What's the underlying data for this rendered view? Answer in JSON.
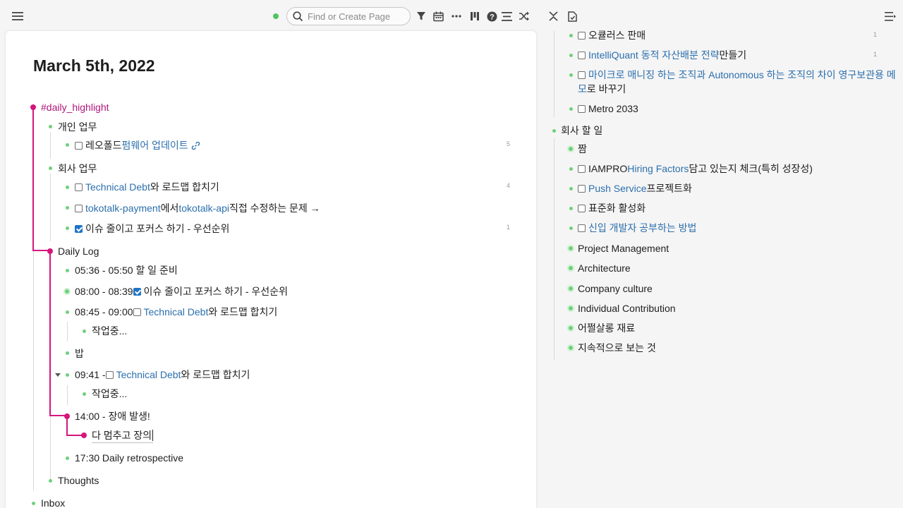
{
  "toolbar": {
    "search_placeholder": "Find or Create Page"
  },
  "colors": {
    "accent": "#d6157c",
    "link": "#2c6fad",
    "bullet": "#6fd07a",
    "checkbox_checked": "#1f74c6"
  },
  "page": {
    "title": "March 5th, 2022",
    "highlight_tag": "#daily_highlight",
    "personal_work": "개인 업무",
    "personal_item_1_pre": "레오폴드 ",
    "personal_item_1_link": "펌웨어 업데이트",
    "personal_item_1_count": "5",
    "company_work": "회사 업무",
    "company_item_1_link": "Technical Debt",
    "company_item_1_rest": "와 로드맵 합치기",
    "company_item_1_count": "4",
    "company_item_2_link1": "tokotalk-payment",
    "company_item_2_mid": "에서 ",
    "company_item_2_link2": "tokotalk-api",
    "company_item_2_rest": " 직접 수정하는 문제 →",
    "company_item_3": "이슈 줄이고 포커스 하기 - 우선순위",
    "company_item_3_count": "1",
    "daily_log": "Daily Log",
    "log_1": "05:36 - 05:50 할 일 준비",
    "log_2_pre": "08:00 - 08:39 ",
    "log_2_text": "이슈 줄이고 포커스 하기 - 우선순위",
    "log_3_pre": "08:45 - 09:00 ",
    "log_3_link": "Technical Debt",
    "log_3_rest": "와 로드맵 합치기",
    "log_3_child": "작업중...",
    "log_4": "밥",
    "log_5_pre": "09:41 - ",
    "log_5_link": "Technical Debt",
    "log_5_rest": "와 로드맵 합치기",
    "log_5_child": "작업중...",
    "log_6": "14:00 - 장애 발생!",
    "log_6_child": "다 멈추고 장의",
    "log_7": "17:30 Daily retrospective",
    "thoughts": "Thoughts",
    "inbox": "Inbox"
  },
  "sidebar": {
    "item_1": "오큘러스 판매",
    "item_1_count": "1",
    "item_2_link": "IntelliQuant 동적 자산배분 전략",
    "item_2_rest": " 만들기",
    "item_2_count": "1",
    "item_3_link_a": "마이크로 매니징 하는 조직과 Autonomous 하는 조직의 차이 영구보관용 메",
    "item_3_link_b": "모",
    "item_3_rest": "로 바꾸기",
    "item_4": "Metro 2033",
    "company_todo": "회사 할 일",
    "c_1": "짬",
    "c_2_pre": "IAMPRO ",
    "c_2_link": "Hiring Factors",
    "c_2_rest": " 담고 있는지 체크(특히 성장성)",
    "c_3_link": "Push Service",
    "c_3_rest": " 프로젝트화",
    "c_4": "표준화 활성화",
    "c_5_link": "신입 개발자 공부하는 방법",
    "c_6": "Project Management",
    "c_7": "Architecture",
    "c_8": "Company culture",
    "c_9": "Individual Contribution",
    "c_10": "어쩔살롱 재료",
    "c_11": "지속적으로 보는 것"
  }
}
